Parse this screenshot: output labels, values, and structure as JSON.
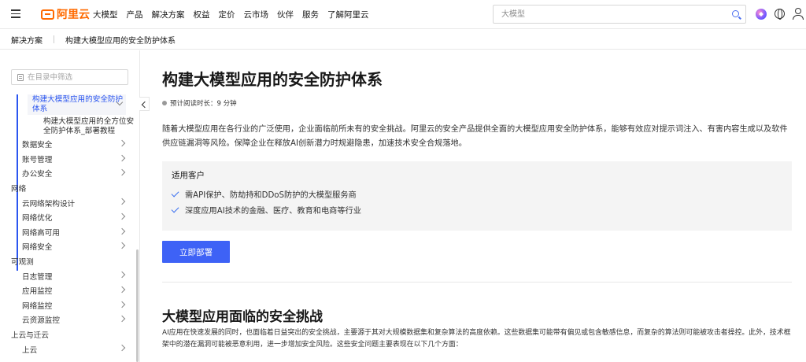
{
  "header": {
    "logo_text": "阿里云",
    "nav": [
      "大模型",
      "产品",
      "解决方案",
      "权益",
      "定价",
      "云市场",
      "伙伴",
      "服务",
      "了解阿里云"
    ],
    "search_placeholder": "大模型",
    "accent_color": "#ff6a00"
  },
  "breadcrumb": {
    "root": "解决方案",
    "current": "构建大模型应用的安全防护体系"
  },
  "sidebar": {
    "filter_placeholder": "在目录中筛选",
    "active_item": "构建大模型应用的安全防护体系",
    "active_sub_item": "构建大模型应用的全方位安全防护体系_部署教程",
    "groups_top": [
      "数据安全",
      "账号管理",
      "办公安全"
    ],
    "group_network": "网络",
    "network_items": [
      "云网络架构设计",
      "网络优化",
      "网络高可用",
      "网络安全"
    ],
    "group_observability": "可观测",
    "observability_items": [
      "日志管理",
      "应用监控",
      "网络监控",
      "云资源监控"
    ],
    "group_migration": "上云与迁云",
    "migration_items": [
      "上云"
    ]
  },
  "main": {
    "title": "构建大模型应用的安全防护体系",
    "read_time": "预计阅读时长：9 分钟",
    "intro": "随着大模型应用在各行业的广泛使用，企业面临前所未有的安全挑战。阿里云的安全产品提供全面的大模型应用安全防护体系，能够有效应对提示词注入、有害内容生成以及软件供应链漏洞等风险。保障企业在释放AI创新潜力时规避隐患，加速技术安全合规落地。",
    "customers_title": "适用客户",
    "customers": [
      "需API保护、防劫持和DDoS防护的大模型服务商",
      "深度应用AI技术的金融、医疗、教育和电商等行业"
    ],
    "deploy_button": "立即部署",
    "section_title": "大模型应用面临的安全挑战",
    "section_text": "AI应用在快速发展的同时，也面临着日益突出的安全挑战，主要源于其对大规模数据集和复杂算法的高度依赖。这些数据集可能带有偏见或包含敏感信息，而复杂的算法则可能被攻击者操控。此外，技术框架中的潜在漏洞可能被恶意利用，进一步增加安全风险。这些安全问题主要表现在以下几个方面："
  }
}
